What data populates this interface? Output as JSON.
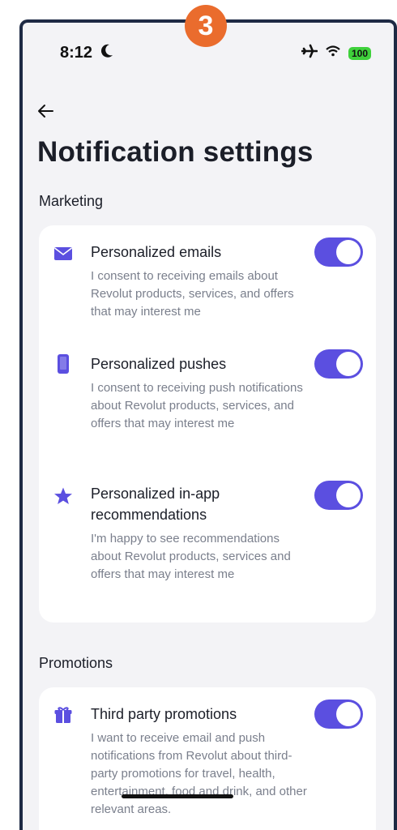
{
  "status_bar": {
    "time": "8:12",
    "battery": "100"
  },
  "step_badge": "3",
  "page_title": "Notification settings",
  "sections": {
    "marketing": {
      "title": "Marketing",
      "items": [
        {
          "title": "Personalized emails",
          "description": "I consent to receiving emails about Revolut products, services, and offers that may interest me",
          "icon": "mail-icon",
          "enabled": true
        },
        {
          "title": "Personalized pushes",
          "description": "I consent to receiving push notifications about Revolut products, services, and offers that may interest me",
          "icon": "phone-icon",
          "enabled": true
        },
        {
          "title": "Personalized in-app recommendations",
          "description": "I'm happy to see recommendations about Revolut products, services and offers that may interest me",
          "icon": "star-icon",
          "enabled": true
        }
      ]
    },
    "promotions": {
      "title": "Promotions",
      "items": [
        {
          "title": "Third party promotions",
          "description": "I want to receive email and push notifications from Revolut about third-party promotions for travel, health, entertainment, food and drink, and other relevant areas.",
          "icon": "gift-icon",
          "enabled": true
        }
      ]
    }
  },
  "colors": {
    "accent": "#5b4fe0",
    "badge": "#ea6c2d",
    "background": "#f3f3f6"
  }
}
